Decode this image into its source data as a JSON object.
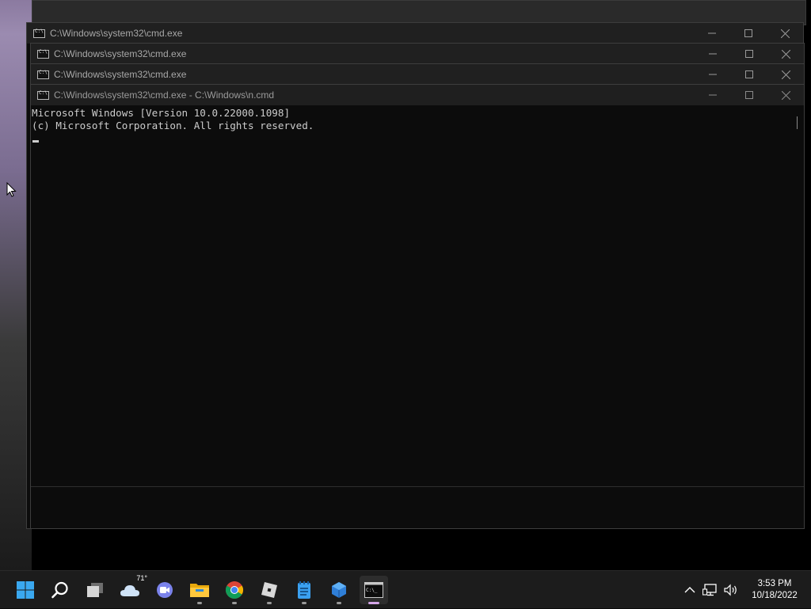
{
  "windows": [
    {
      "title": "C:\\Windows\\system32\\cmd.exe"
    },
    {
      "title": "C:\\Windows\\system32\\cmd.exe"
    },
    {
      "title": "C:\\Windows\\system32\\cmd.exe"
    },
    {
      "title": "C:\\Windows\\system32\\cmd.exe - C:\\Windows\\n.cmd"
    }
  ],
  "console": {
    "lines": [
      "Microsoft Windows [Version 10.0.22000.1098]",
      "(c) Microsoft Corporation. All rights reserved."
    ]
  },
  "taskbar": {
    "weather_temp": "71°",
    "icons": [
      "windows-start-icon",
      "search-icon",
      "task-view-icon",
      "weather-icon",
      "chat-icon",
      "file-explorer-icon",
      "chrome-icon",
      "roblox-icon",
      "notepad-icon",
      "app-cube-icon",
      "cmd-icon"
    ]
  },
  "tray": {
    "time": "3:53 PM",
    "date": "10/18/2022"
  }
}
